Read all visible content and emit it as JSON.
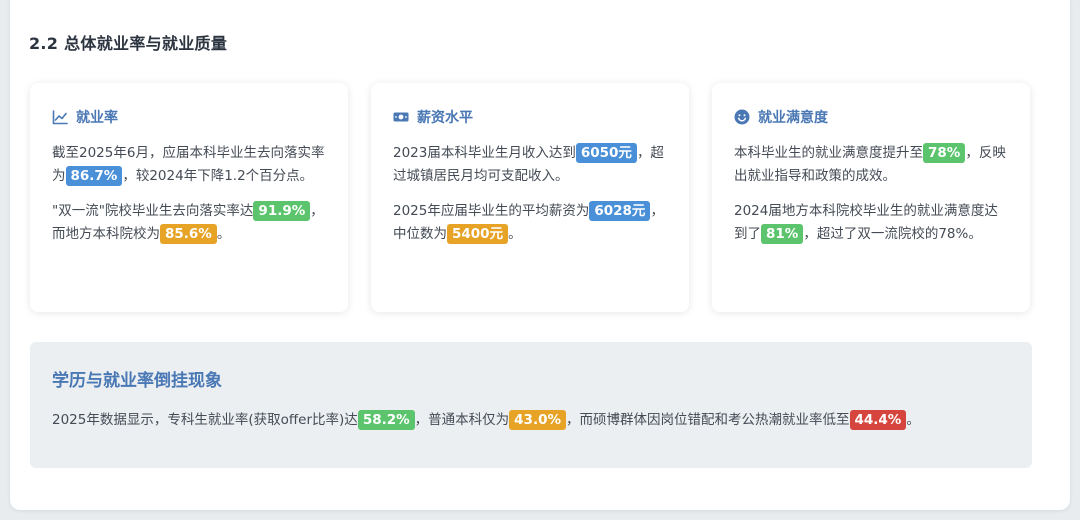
{
  "section": {
    "title": "2.2 总体就业率与就业质量"
  },
  "cards": [
    {
      "icon": "line-chart-icon",
      "title": "就业率",
      "p1": {
        "pre": "截至2025年6月，应届本科毕业生去向落实率为",
        "hl": "86.7%",
        "post": "，较2024年下降1.2个百分点。"
      },
      "p2": {
        "pre": "\"双一流\"院校毕业生去向落实率达",
        "hl1": "91.9%",
        "mid": "，而地方本科院校为",
        "hl2": "85.6%",
        "post": "。"
      }
    },
    {
      "icon": "money-icon",
      "title": "薪资水平",
      "p1": {
        "pre": "2023届本科毕业生月收入达到",
        "hl": "6050元",
        "post": "，超过城镇居民月均可支配收入。"
      },
      "p2": {
        "pre": "2025年应届毕业生的平均薪资为",
        "hl1": "6028元",
        "mid": "，中位数为",
        "hl2": "5400元",
        "post": "。"
      }
    },
    {
      "icon": "smile-icon",
      "title": "就业满意度",
      "p1": {
        "pre": "本科毕业生的就业满意度提升至",
        "hl": "78%",
        "post": "，反映出就业指导和政策的成效。"
      },
      "p2": {
        "pre": "2024届地方本科院校毕业生的就业满意度达到了",
        "hl": "81%",
        "post": "，超过了双一流院校的78%。"
      }
    }
  ],
  "phenomenon": {
    "title": "学历与就业率倒挂现象",
    "t1": "2025年数据显示，专科生就业率(获取offer比率)达",
    "h1": "58.2%",
    "t2": "，普通本科仅为",
    "h2": "43.0%",
    "t3": "，而硕博群体因岗位错配和考公热潮就业率低至",
    "h3": "44.4%",
    "t4": "。"
  },
  "colors": {
    "blue": "#4a90d9",
    "green": "#5cc46c",
    "orange": "#e6a325",
    "red": "#d6453d",
    "heading": "#4a78b5"
  }
}
